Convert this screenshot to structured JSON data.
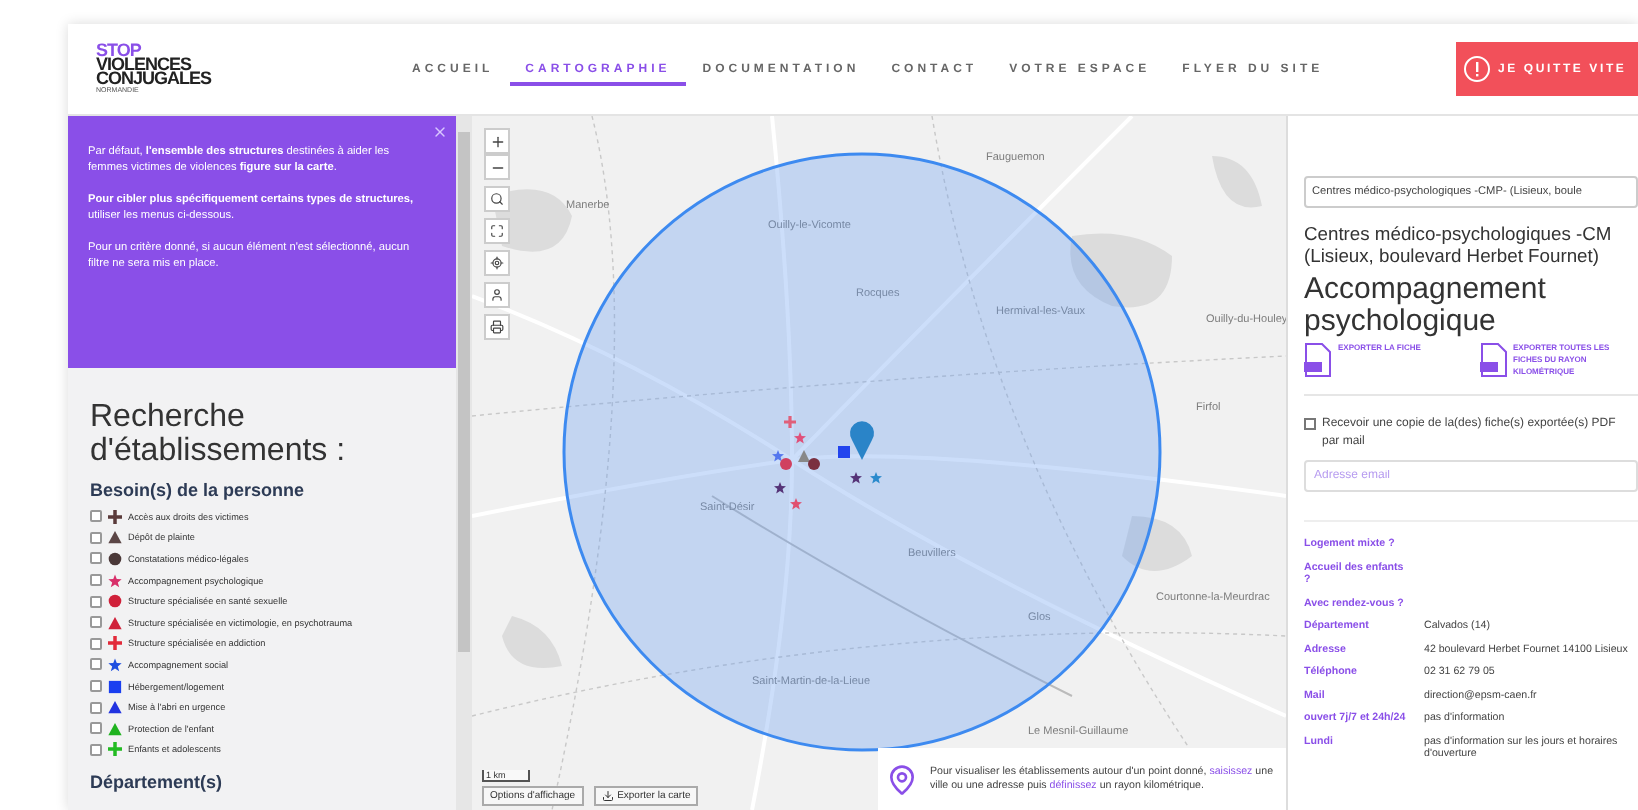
{
  "logo": {
    "lines": [
      "STOP",
      "VIOLENCES",
      "CONJUGALES"
    ],
    "region": "NORMANDIE"
  },
  "nav": [
    {
      "label": "ACCUEIL",
      "selected": false
    },
    {
      "label": "CARTOGRAPHIE",
      "selected": true
    },
    {
      "label": "DOCUMENTATION",
      "selected": false
    },
    {
      "label": "CONTACT",
      "selected": false
    },
    {
      "label": "VOTRE ESPACE",
      "selected": false
    },
    {
      "label": "FLYER DU SITE",
      "selected": false
    }
  ],
  "quit_button": {
    "label": "JE QUITTE VITE"
  },
  "intro": [
    "Par défaut, **l'ensemble des structures** destinées à aider les femmes victimes de violences **figure sur la carte**.",
    "**Pour cibler plus spécifiquement certains types de structures,** utiliser les menus ci-dessous.",
    "Pour un critère donné, si aucun élément n'est sélectionné, aucun filtre ne sera mis en place."
  ],
  "search_title": "Recherche d'établissements :",
  "needs_title": "Besoin(s) de la personne",
  "needs": [
    {
      "label": "Accès aux droits des victimes",
      "kind": "cross",
      "color": "#5a3a3a",
      "checked": false
    },
    {
      "label": "Dépôt de plainte",
      "kind": "triangle",
      "color": "#5b4646",
      "checked": false
    },
    {
      "label": "Constatations médico-légales",
      "kind": "circle",
      "color": "#4a3838",
      "checked": false
    },
    {
      "label": "Accompagnement psychologique",
      "kind": "star",
      "color": "#d8306a",
      "checked": false
    },
    {
      "label": "Structure spécialisée en santé sexuelle",
      "kind": "circle",
      "color": "#d0213a",
      "checked": false
    },
    {
      "label": "Structure spécialisée en victimologie, en psychotrauma",
      "kind": "triangle",
      "color": "#d0213a",
      "checked": false
    },
    {
      "label": "Structure spécialisée en addiction",
      "kind": "cross",
      "color": "#e22a3a",
      "checked": false
    },
    {
      "label": "Accompagnement social",
      "kind": "star",
      "color": "#1f4fe0",
      "checked": false
    },
    {
      "label": "Hébergement/logement",
      "kind": "square",
      "color": "#1a3ff0",
      "checked": false
    },
    {
      "label": "Mise à l'abri en urgence",
      "kind": "triangle",
      "color": "#2233e0",
      "checked": false
    },
    {
      "label": "Protection de l'enfant",
      "kind": "triangle",
      "color": "#1fb31f",
      "checked": false
    },
    {
      "label": "Enfants et adolescents",
      "kind": "cross",
      "color": "#22bb22",
      "checked": false
    }
  ],
  "departments_title": "Département(s)",
  "map": {
    "places": [
      "Fauguemon",
      "Manerbe",
      "Ouilly-le-Vicomte",
      "Rocques",
      "Hermival-les-Vaux",
      "Ouilly-du-Houley",
      "Firfol",
      "Saint-Désir",
      "Beuvillers",
      "Glos",
      "Courtonne-la-Meurdrac",
      "Saint-Martin-de-la-Lieue",
      "Le Mesnil-Guillaume"
    ],
    "scale": "1 km",
    "options_button": "Options d'affichage",
    "export_button": "Exporter la carte",
    "hint": "Pour visualiser les établissements autour d'un point donné, **saisissez** une ville ou une adresse puis **définissez** un rayon kilométrique."
  },
  "detail": {
    "select_value": "Centres médico-psychologiques -CMP- (Lisieux, boule",
    "title_lines": [
      "Centres médico-psychologiques -CM",
      "(Lisieux, boulevard Herbet Fournet)"
    ],
    "category": "Accompagnement psychologique",
    "exports": [
      "EXPORTER LA FICHE",
      "EXPORTER TOUTES LES FICHES DU RAYON KILOMÉTRIQUE"
    ],
    "copy_checkbox": {
      "label": "Recevoir une copie de la(des) fiche(s) exportée(s) PDF par mail",
      "checked": false
    },
    "email_placeholder": "Adresse email",
    "rows": [
      {
        "label": "Logement mixte ?"
      },
      {
        "label": "Accueil des enfants ?"
      },
      {
        "label": "Avec rendez-vous ?"
      },
      {
        "label": "Département",
        "value": "Calvados (14)"
      },
      {
        "label": "Adresse",
        "value": "42 boulevard Herbet Fournet 14100 Lisieux"
      },
      {
        "label": "Téléphone",
        "value": "02 31 62 79 05"
      },
      {
        "label": "Mail",
        "value": "direction@epsm-caen.fr"
      },
      {
        "label": "ouvert 7j/7 et 24h/24",
        "value": "pas d'information"
      },
      {
        "label": "Lundi",
        "value": "pas d'information sur les jours et horaires d'ouverture"
      }
    ]
  }
}
